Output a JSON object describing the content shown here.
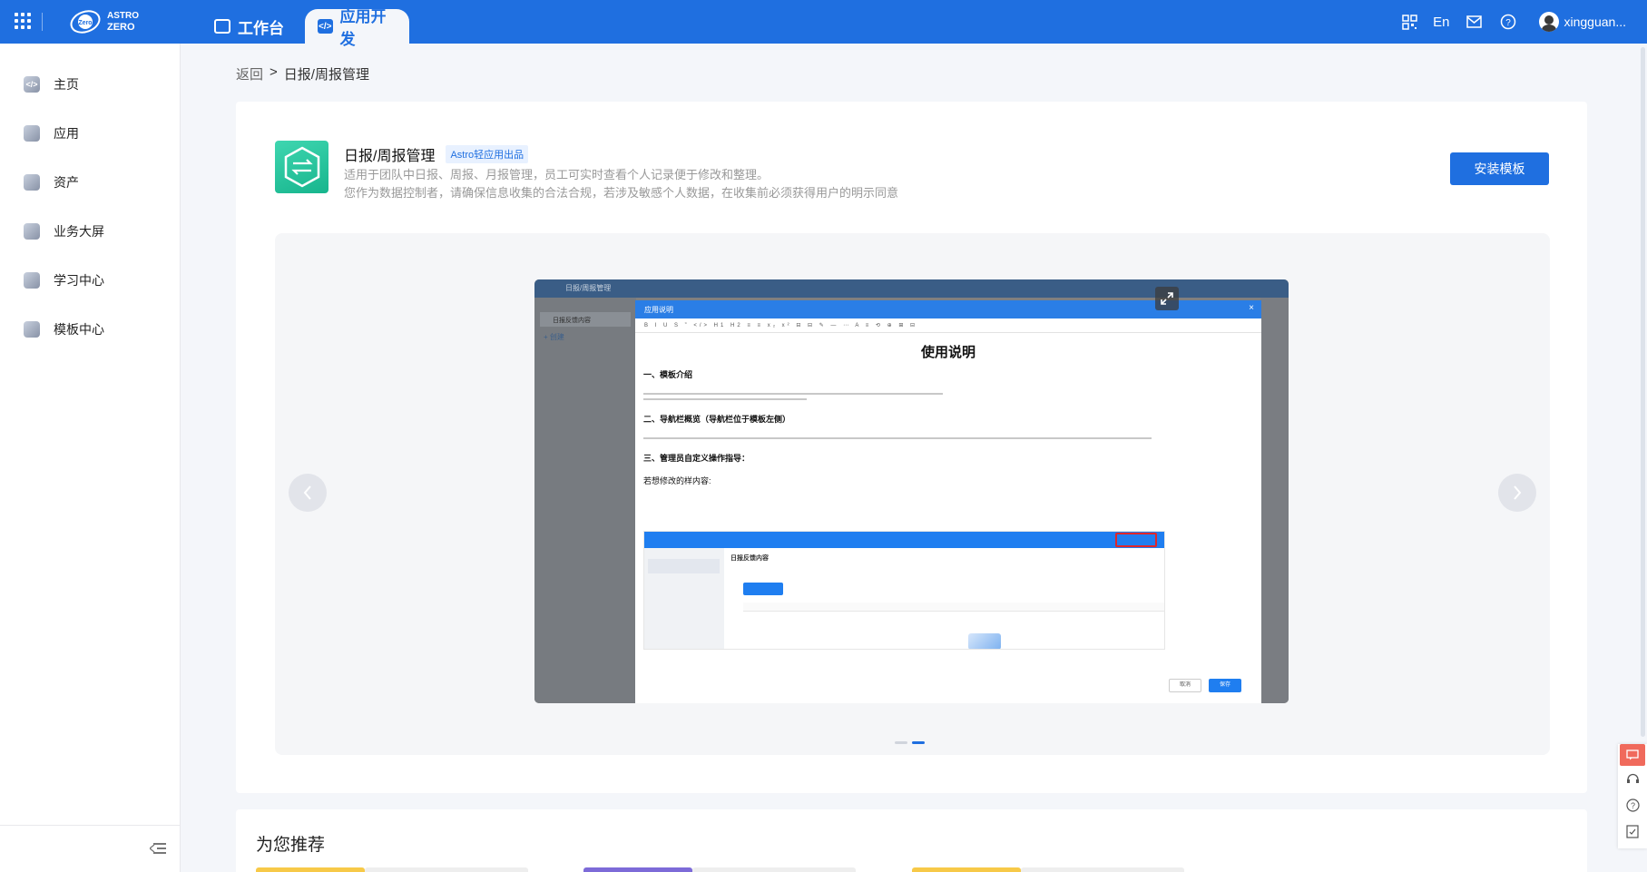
{
  "topbar": {
    "logo_line1": "ASTRO",
    "logo_line2": "ZERO",
    "logo_badge": "Zero",
    "tabs": [
      {
        "label": "工作台"
      },
      {
        "label": "应用开发"
      }
    ],
    "lang": "En",
    "username": "xingguan..."
  },
  "sidebar": {
    "items": [
      {
        "label": "主页",
        "icon": "home-code-icon"
      },
      {
        "label": "应用",
        "icon": "app-icon"
      },
      {
        "label": "资产",
        "icon": "asset-icon"
      },
      {
        "label": "业务大屏",
        "icon": "dashboard-icon"
      },
      {
        "label": "学习中心",
        "icon": "learning-icon"
      },
      {
        "label": "模板中心",
        "icon": "template-icon"
      }
    ]
  },
  "breadcrumb": {
    "back": "返回",
    "sep": ">",
    "current": "日报/周报管理"
  },
  "template": {
    "title": "日报/周报管理",
    "badge": "Astro轻应用出品",
    "desc1": "适用于团队中日报、周报、月报管理，员工可实时查看个人记录便于修改和整理。",
    "desc2": "您作为数据控制者，请确保信息收集的合法合规，若涉及敏感个人数据，在收集前必须获得用户的明示同意",
    "install_label": "安装模板",
    "accent_color": "#1f6fe0",
    "logo_color": "#26c49c"
  },
  "carousel": {
    "active_slide": 2,
    "slide_count": 2
  },
  "preview": {
    "app_name": "日报/周报管理",
    "sidebar_item": "日报反馈内容",
    "sidebar_new": "+ 创建",
    "modal_title": "应用说明",
    "doc_title": "使用说明",
    "sections": [
      "一、模板介绍",
      "二、导航栏概览（导航栏位于模板左侧）",
      "三、管理员自定义操作指导："
    ],
    "note": "若想修改的样内容:",
    "inner_title": "日报反馈内容",
    "cancel": "取消",
    "save": "保存"
  },
  "recommend": {
    "title": "为您推荐"
  }
}
